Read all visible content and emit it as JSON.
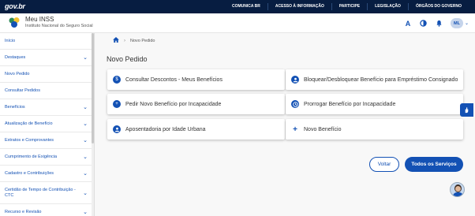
{
  "govbar": {
    "logo": "gov.br",
    "links": [
      "COMUNICA BR",
      "ACESSO À INFORMAÇÃO",
      "PARTICIPE",
      "LEGISLAÇÃO",
      "ÓRGÃOS DO GOVERNO"
    ]
  },
  "header": {
    "app_name": "Meu INSS",
    "app_subtitle": "Instituto Nacional do Seguro Social",
    "tools": {
      "font_label": "A",
      "avatar_initials": "ML"
    }
  },
  "sidebar": {
    "items": [
      {
        "label": "Início",
        "has_chevron": false
      },
      {
        "label": "Destaques",
        "has_chevron": true
      },
      {
        "label": "Novo Pedido",
        "has_chevron": false
      },
      {
        "label": "Consultar Pedidos",
        "has_chevron": false
      },
      {
        "label": "Benefícios",
        "has_chevron": true
      },
      {
        "label": "Atualização de Benefício",
        "has_chevron": true
      },
      {
        "label": "Extratos e Comprovantes",
        "has_chevron": true
      },
      {
        "label": "Cumprimento de Exigência",
        "has_chevron": true
      },
      {
        "label": "Cadastro e Contribuições",
        "has_chevron": true
      },
      {
        "label": "Certidão de Tempo de Contribuição - CTC",
        "has_chevron": true
      },
      {
        "label": "Recurso e Revisão",
        "has_chevron": true
      }
    ]
  },
  "breadcrumb": {
    "current": "Novo Pedido"
  },
  "main": {
    "title": "Novo Pedido",
    "cards": [
      {
        "label": "Consultar Descontos - Meus Benefícios",
        "icon": "money-icon"
      },
      {
        "label": "Bloquear/Desbloquear Benefício para Empréstimo Consignado",
        "icon": "user-lock-icon"
      },
      {
        "label": "Pedir Novo Benefício por Incapacidade",
        "icon": "medical-bag-icon"
      },
      {
        "label": "Prorrogar Benefício por Incapacidade",
        "icon": "clock-icon"
      },
      {
        "label": "Aposentadoria por Idade Urbana",
        "icon": "elderly-user-icon"
      },
      {
        "label": "Novo Benefício",
        "icon": "plus-icon"
      }
    ],
    "buttons": {
      "back": "Voltar",
      "all_services": "Todos os Serviços"
    }
  },
  "colors": {
    "primary": "#1351b4",
    "govbar": "#071d41"
  }
}
